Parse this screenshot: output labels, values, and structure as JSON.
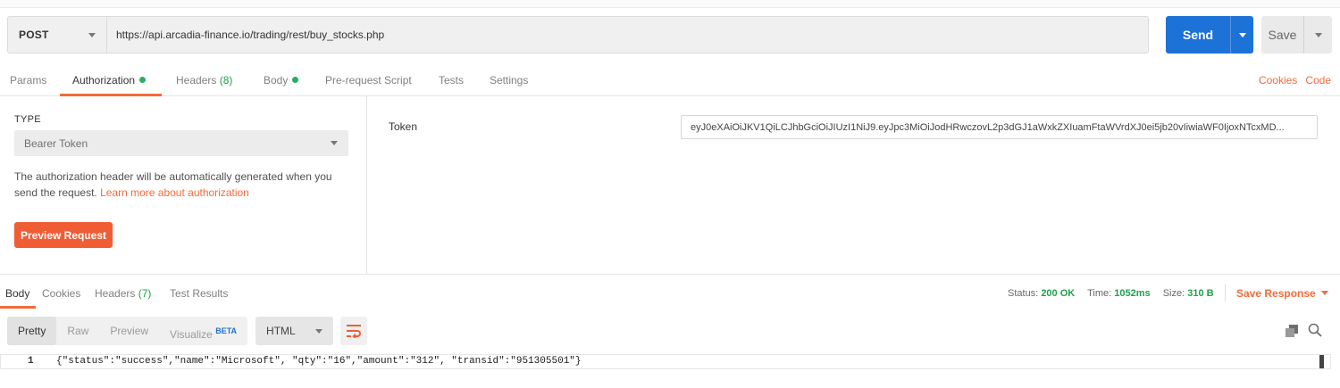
{
  "request": {
    "method": "POST",
    "url": "https://api.arcadia-finance.io/trading/rest/buy_stocks.php",
    "send_label": "Send",
    "save_label": "Save"
  },
  "request_tabs": [
    {
      "label": "Params"
    },
    {
      "label": "Authorization"
    },
    {
      "label": "Headers",
      "count": "(8)"
    },
    {
      "label": "Body"
    },
    {
      "label": "Pre-request Script"
    },
    {
      "label": "Tests"
    },
    {
      "label": "Settings"
    }
  ],
  "links": {
    "cookies": "Cookies",
    "code": "Code"
  },
  "auth": {
    "type_label": "TYPE",
    "type_value": "Bearer Token",
    "description": "The authorization header will be automatically generated when you send the request.",
    "learn_more": "Learn more about authorization",
    "preview_button": "Preview Request",
    "token_label": "Token",
    "token_value": "eyJ0eXAiOiJKV1QiLCJhbGciOiJIUzI1NiJ9.eyJpc3MiOiJodHRwczovL2p3dGJ1aWxkZXIuamFtaWVrdXJ0ei5jb20vIiwiaWF0IjoxNTcxMD..."
  },
  "response_tabs": [
    {
      "label": "Body"
    },
    {
      "label": "Cookies"
    },
    {
      "label": "Headers",
      "count": "(7)"
    },
    {
      "label": "Test Results"
    }
  ],
  "status": {
    "status_label": "Status:",
    "status_value": "200 OK",
    "time_label": "Time:",
    "time_value": "1052ms",
    "size_label": "Size:",
    "size_value": "310 B",
    "save_response": "Save Response"
  },
  "response_toolbar": {
    "formats": [
      "Pretty",
      "Raw",
      "Preview",
      "Visualize"
    ],
    "beta": "BETA",
    "language": "HTML"
  },
  "code": {
    "line_number": "1",
    "content": "{\"status\":\"success\",\"name\":\"Microsoft\", \"qty\":\"16\",\"amount\":\"312\", \"transid\":\"951305501\"}"
  },
  "colors": {
    "accent": "#f26b3a",
    "send": "#1d72d8",
    "status_ok": "#20a04b"
  }
}
